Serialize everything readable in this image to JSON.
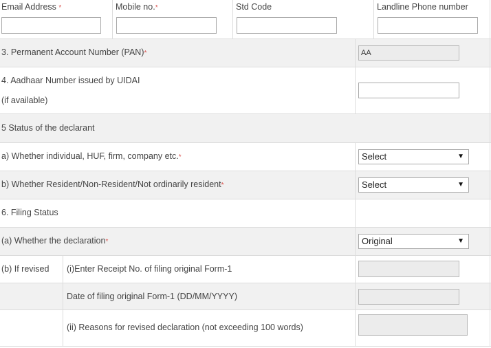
{
  "contact": {
    "email_label": "Email Address",
    "mobile_label": "Mobile no.",
    "std_label": "Std Code",
    "landline_label": "Landline Phone number",
    "required_mark": "*"
  },
  "pan": {
    "label": "3. Permanent Account Number (PAN)",
    "value": "AA"
  },
  "aadhaar": {
    "label": "4. Aadhaar Number issued by UIDAI",
    "sublabel": "(if available)"
  },
  "status": {
    "heading": "5 Status of the declarant",
    "a_label": "a) Whether individual, HUF, firm, company etc.",
    "a_value": "Select",
    "b_label": "b) Whether Resident/Non-Resident/Not ordinarily resident",
    "b_value": "Select"
  },
  "filing": {
    "heading": "6. Filing Status",
    "a_label": "(a) Whether the declaration",
    "a_value": "Original",
    "b_label": "(b) If revised",
    "receipt_label": "(i)Enter Receipt No. of filing original Form-1",
    "date_label": "Date of filing original Form-1 (DD/MM/YYYY)",
    "reasons_label": "(ii) Reasons for revised declaration (not exceeding 100 words)"
  }
}
